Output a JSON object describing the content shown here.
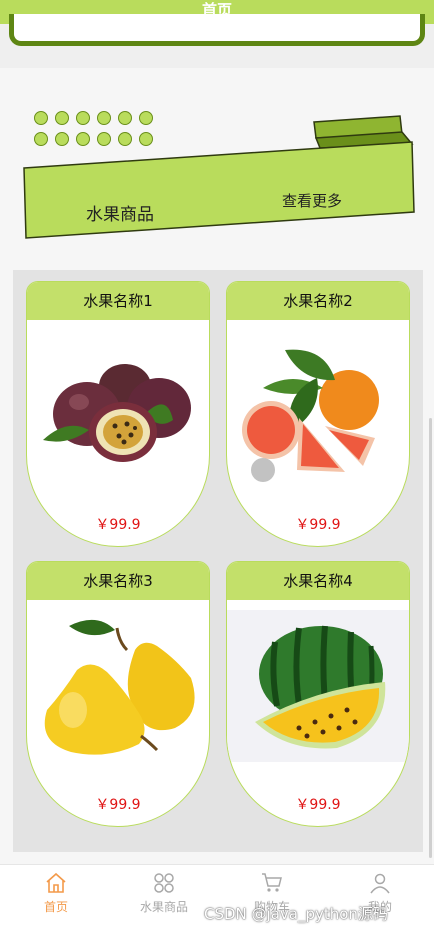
{
  "header": {
    "title": "首页"
  },
  "section": {
    "title": "水果商品",
    "more_label": "查看更多"
  },
  "products": [
    {
      "name": "水果名称1",
      "price": "￥99.9",
      "image": "passion-fruit"
    },
    {
      "name": "水果名称2",
      "price": "￥99.9",
      "image": "grapefruit"
    },
    {
      "name": "水果名称3",
      "price": "￥99.9",
      "image": "pear"
    },
    {
      "name": "水果名称4",
      "price": "￥99.9",
      "image": "watermelon"
    }
  ],
  "tabbar": {
    "items": [
      {
        "label": "首页",
        "icon": "home-icon",
        "active": true
      },
      {
        "label": "水果商品",
        "icon": "grid-icon",
        "active": false
      },
      {
        "label": "购物车",
        "icon": "cart-icon",
        "active": false
      },
      {
        "label": "我的",
        "icon": "user-icon",
        "active": false
      }
    ]
  },
  "watermark": "CSDN @java_python源码",
  "colors": {
    "accent": "#b9dc5c",
    "dark_green": "#5e8614",
    "price": "#e01414",
    "active_tab": "#f39a4a"
  }
}
